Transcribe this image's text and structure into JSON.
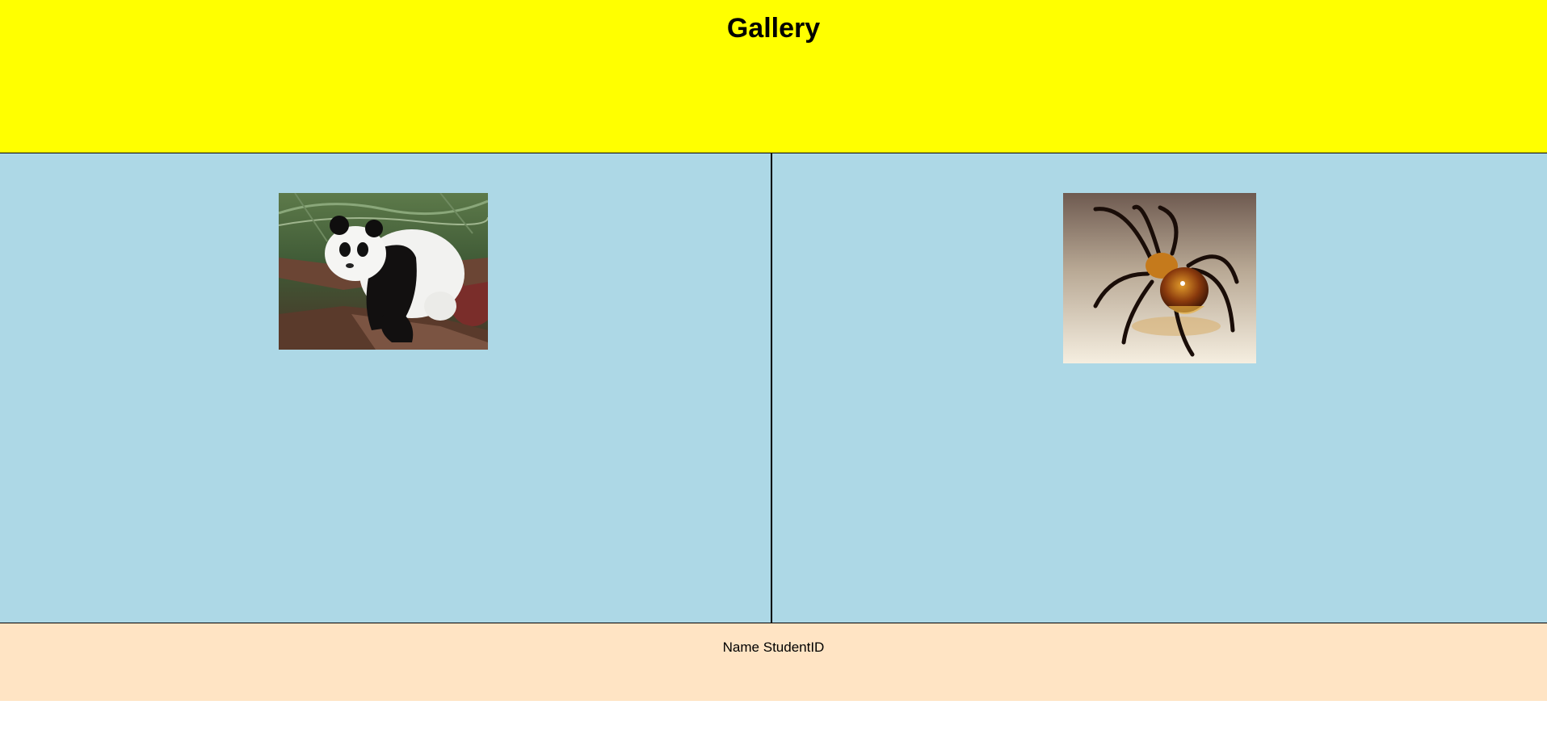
{
  "header": {
    "title": "Gallery",
    "background": "#ffff00"
  },
  "gallery": {
    "background": "#add8e6",
    "images": [
      {
        "subject": "giant panda resting on tree branch",
        "icon": "panda-photo"
      },
      {
        "subject": "glass sculpture of an amber spider",
        "icon": "spider-photo"
      }
    ]
  },
  "footer": {
    "text": "Name StudentID",
    "background": "#ffe4c4"
  }
}
